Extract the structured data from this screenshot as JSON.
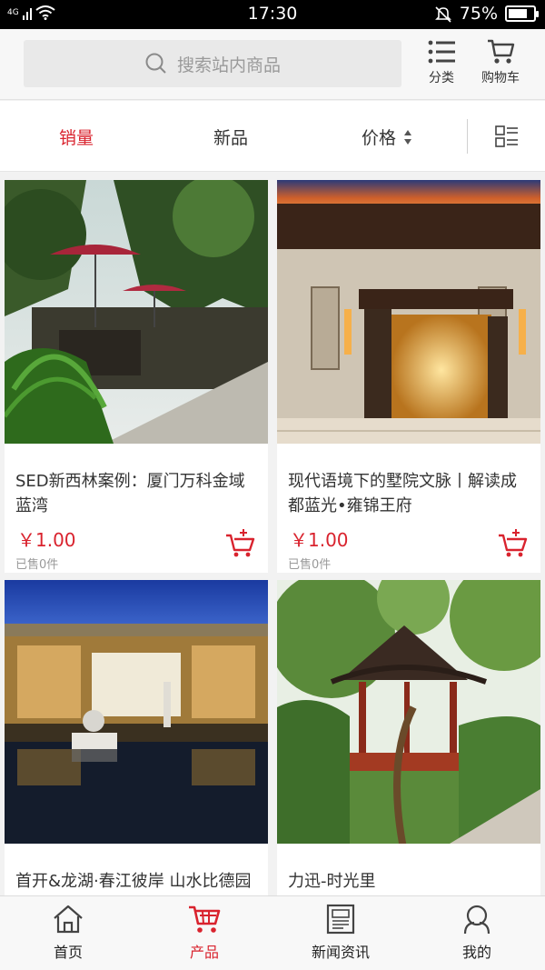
{
  "status_bar": {
    "network": "4G",
    "time": "17:30",
    "battery": "75%",
    "battery_level": 0.75,
    "icons": [
      "wifi-icon",
      "silent-bell-icon",
      "battery-icon"
    ]
  },
  "header": {
    "search_placeholder": "搜索站内商品",
    "category_label": "分类",
    "cart_label": "购物车"
  },
  "sort_tabs": {
    "sales": "销量",
    "new": "新品",
    "price": "价格",
    "active": "sales"
  },
  "products": [
    {
      "title": "SED新西林案例：厦门万科金域蓝湾",
      "price": "￥1.00",
      "sold": "已售0件"
    },
    {
      "title": "现代语境下的墅院文脉丨解读成都蓝光•雍锦王府",
      "price": "￥1.00",
      "sold": "已售0件"
    },
    {
      "title": "首开&龙湖·春江彼岸 山水比德园林集团",
      "price": "",
      "sold": ""
    },
    {
      "title": "力迅-时光里",
      "price": "",
      "sold": ""
    }
  ],
  "tabbar": {
    "home": "首页",
    "products": "产品",
    "news": "新闻资讯",
    "mine": "我的",
    "active": "products"
  },
  "colors": {
    "accent": "#d9232e",
    "text": "#333333",
    "muted": "#9a9a9a"
  }
}
